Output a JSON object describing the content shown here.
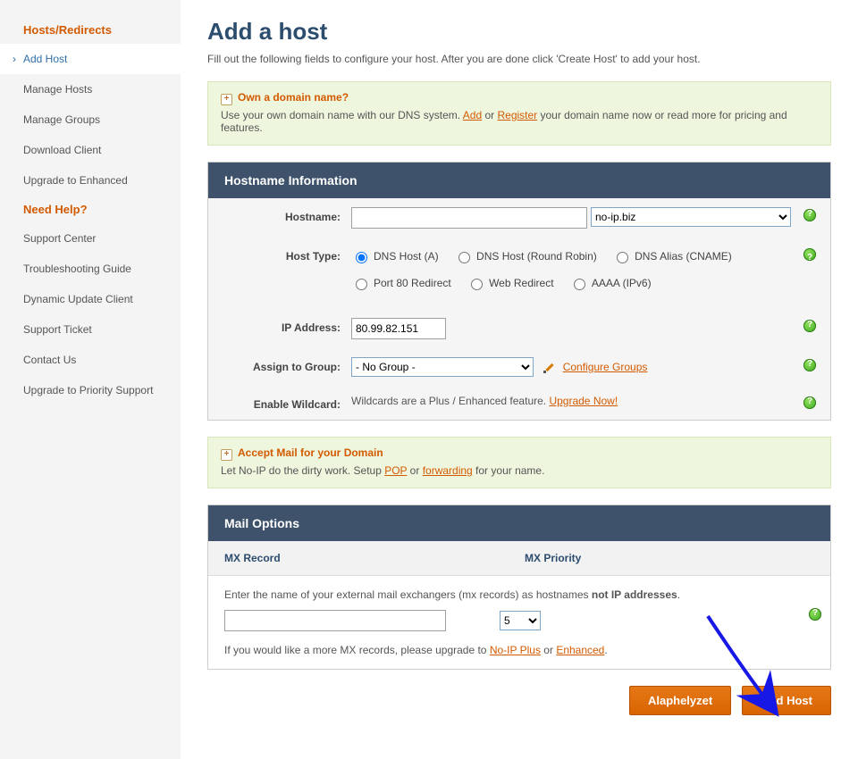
{
  "sidebar": {
    "section1": "Hosts/Redirects",
    "items1": [
      "Add Host",
      "Manage Hosts",
      "Manage Groups",
      "Download Client",
      "Upgrade to Enhanced"
    ],
    "section2": "Need Help?",
    "items2": [
      "Support Center",
      "Troubleshooting Guide",
      "Dynamic Update Client",
      "Support Ticket",
      "Contact Us",
      "Upgrade to Priority Support"
    ]
  },
  "title": "Add a host",
  "subtitle": "Fill out the following fields to configure your host. After you are done click 'Create Host' to add your host.",
  "domainBox": {
    "title": "Own a domain name?",
    "pre": "Use your own domain name with our DNS system. ",
    "addLink": "Add",
    "or": " or ",
    "regLink": "Register",
    "post": " your domain name now or read more for pricing and features."
  },
  "panel1": {
    "header": "Hostname Information",
    "hostnameLabel": "Hostname:",
    "domainSelected": "no-ip.biz",
    "hostTypeLabel": "Host Type:",
    "types": [
      "DNS Host (A)",
      "DNS Host (Round Robin)",
      "DNS Alias (CNAME)",
      "Port 80 Redirect",
      "Web Redirect",
      "AAAA (IPv6)"
    ],
    "ipLabel": "IP Address:",
    "ipValue": "80.99.82.151",
    "groupLabel": "Assign to Group:",
    "groupSelected": "- No Group -",
    "configGroups": "Configure Groups",
    "wildcardLabel": "Enable Wildcard:",
    "wildcardText": "Wildcards are a Plus / Enhanced feature. ",
    "wildcardLink": "Upgrade Now!"
  },
  "mailBox": {
    "title": "Accept Mail for your Domain",
    "pre": "Let No-IP do the dirty work. Setup ",
    "pop": "POP",
    "or": " or ",
    "fwd": "forwarding",
    "post": " for your name."
  },
  "panel2": {
    "header": "Mail Options",
    "col1": "MX Record",
    "col2": "MX Priority",
    "intro1": "Enter the name of your external mail exchangers (mx records) as hostnames ",
    "introBold": "not IP addresses",
    "introEnd": ".",
    "prioritySelected": "5",
    "more1": "If you would like a more MX records, please upgrade to ",
    "plusLink": "No-IP Plus",
    "more2": " or ",
    "enhLink": "Enhanced",
    "more3": "."
  },
  "buttons": {
    "reset": "Alaphelyzet",
    "submit": "Add Host"
  }
}
